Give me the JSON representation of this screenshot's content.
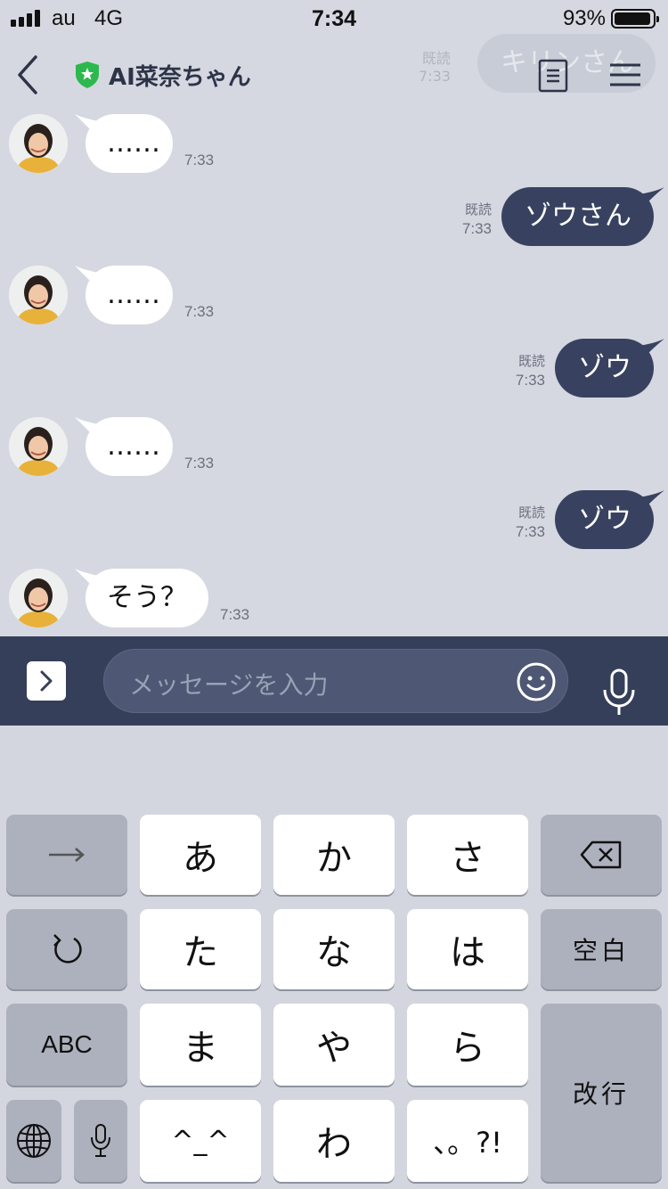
{
  "status_bar": {
    "carrier": "au",
    "network": "4G",
    "time": "7:34",
    "battery_percent": "93%",
    "battery_level": 0.93
  },
  "header": {
    "title": "AI菜奈ちゃん",
    "ghost_bubble_text": "キリンさん",
    "ghost_read": "既読",
    "ghost_time": "7:33",
    "shield_color": "#2db84d"
  },
  "messages": [
    {
      "side": "in",
      "text": "……",
      "time": "7:33"
    },
    {
      "side": "out",
      "text": "ゾウさん",
      "read": "既読",
      "time": "7:33"
    },
    {
      "side": "in",
      "text": "……",
      "time": "7:33"
    },
    {
      "side": "out",
      "text": "ゾウ",
      "read": "既読",
      "time": "7:33"
    },
    {
      "side": "in",
      "text": "……",
      "time": "7:33"
    },
    {
      "side": "out",
      "text": "ゾウ",
      "read": "既読",
      "time": "7:33"
    },
    {
      "side": "in",
      "text": "そう？",
      "time": "7:33"
    }
  ],
  "input": {
    "placeholder": "メッセージを入力"
  },
  "keyboard": {
    "row1": [
      "あ",
      "か",
      "さ"
    ],
    "row2": [
      "た",
      "な",
      "は"
    ],
    "row3": [
      "ま",
      "や",
      "ら"
    ],
    "row4": [
      "^_^",
      "わ",
      "、。?!"
    ],
    "space": "空白",
    "enter": "改行",
    "abc": "ABC"
  },
  "colors": {
    "outgoing_bubble": "#384260",
    "incoming_bubble": "#ffffff",
    "chat_background": "#d5d8e0",
    "input_bar": "#363f5a"
  },
  "icons": [
    "back-chevron-icon",
    "shield-star-icon",
    "notes-icon",
    "menu-icon",
    "expand-arrow-icon",
    "emoji-icon",
    "microphone-icon",
    "arrow-right-icon",
    "backspace-icon",
    "undo-icon",
    "globe-icon"
  ]
}
